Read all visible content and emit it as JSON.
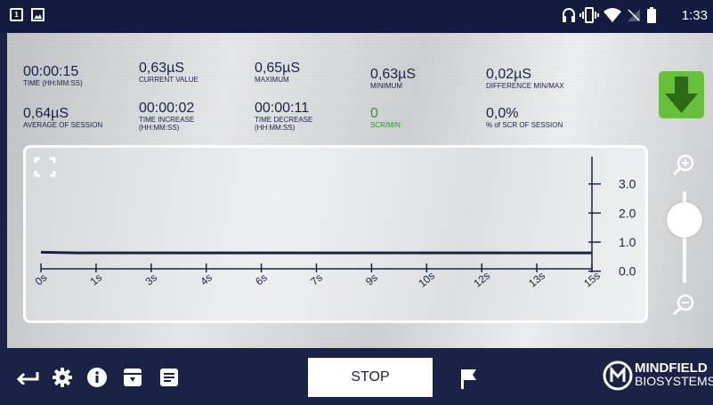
{
  "status_bar": {
    "time": "1:33",
    "icons": [
      "notification-box-icon",
      "image-icon",
      "headset-icon",
      "vibrate-icon",
      "wifi-icon",
      "no-signal-icon",
      "battery-icon"
    ]
  },
  "stats": [
    {
      "value": "00:00:15",
      "label": "TIME (HH:MM:SS)"
    },
    {
      "value": "0,63µS",
      "label": "CURRENT VALUE"
    },
    {
      "value": "0,65µS",
      "label": "MAXIMUM"
    },
    {
      "value": "0,63µS",
      "label": "MINIMUM"
    },
    {
      "value": "0,02µS",
      "label": "DIFFERENCE MIN/MAX"
    },
    {
      "value": "0,64µS",
      "label": "AVERAGE OF SESSION"
    },
    {
      "value": "00:00:02",
      "label": "TIME INCREASE",
      "label2": "(HH:MM:SS)"
    },
    {
      "value": "00:00:11",
      "label": "TIME DECREASE",
      "label2": "(HH:MM:SS)"
    },
    {
      "value": "0",
      "label": "SCR/MIN"
    },
    {
      "value": "0,0%",
      "label": "% of SCR OF SESSION"
    }
  ],
  "colors": {
    "navy": "#1a2346",
    "green": "#68bf3c",
    "scr_green": "#2d9a2a"
  },
  "chart_data": {
    "type": "line",
    "x_tick_labels": [
      "0s",
      "1s",
      "3s",
      "4s",
      "6s",
      "7s",
      "9s",
      "10s",
      "12s",
      "13s",
      "15s"
    ],
    "y_tick_labels": [
      "3.0",
      "2.0",
      "1.0",
      "0.0"
    ],
    "y_ticks": [
      3.0,
      2.0,
      1.0,
      0.0
    ],
    "xlim": [
      0,
      15
    ],
    "ylim": [
      -0.5,
      4.0
    ],
    "series": [
      {
        "x": [
          0,
          0.5,
          1,
          2,
          4,
          6,
          8,
          10,
          12,
          14,
          15
        ],
        "y": [
          0.65,
          0.64,
          0.63,
          0.63,
          0.63,
          0.63,
          0.63,
          0.63,
          0.63,
          0.63,
          0.63
        ]
      }
    ]
  },
  "controls": {
    "stop_label": "STOP",
    "brand_line1": "MINDFIELD",
    "brand_line2": "BIOSYSTEMS"
  }
}
